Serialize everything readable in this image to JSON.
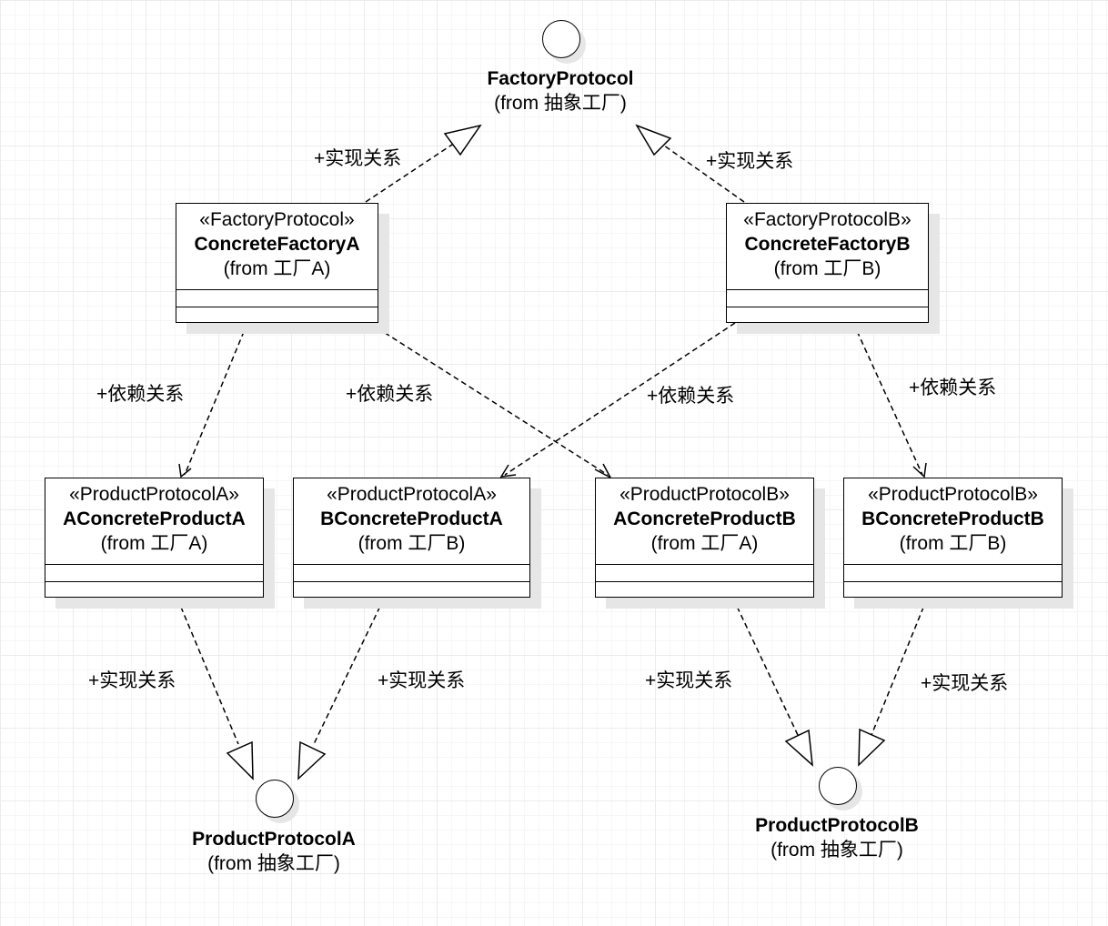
{
  "interfaces": {
    "factory_protocol": {
      "name": "FactoryProtocol",
      "from": "(from 抽象工厂)"
    },
    "product_protocol_a": {
      "name": "ProductProtocolA",
      "from": "(from 抽象工厂)"
    },
    "product_protocol_b": {
      "name": "ProductProtocolB",
      "from": "(from 抽象工厂)"
    }
  },
  "classes": {
    "concrete_factory_a": {
      "stereotype": "«FactoryProtocol»",
      "name": "ConcreteFactoryA",
      "from": "(from 工厂A)"
    },
    "concrete_factory_b": {
      "stereotype": "«FactoryProtocolB»",
      "name": "ConcreteFactoryB",
      "from": "(from 工厂B)"
    },
    "a_concrete_product_a": {
      "stereotype": "«ProductProtocolA»",
      "name": "AConcreteProductA",
      "from": "(from 工厂A)"
    },
    "b_concrete_product_a": {
      "stereotype": "«ProductProtocolA»",
      "name": "BConcreteProductA",
      "from": "(from 工厂B)"
    },
    "a_concrete_product_b": {
      "stereotype": "«ProductProtocolB»",
      "name": "AConcreteProductB",
      "from": "(from 工厂A)"
    },
    "b_concrete_product_b": {
      "stereotype": "«ProductProtocolB»",
      "name": "BConcreteProductB",
      "from": "(from 工厂B)"
    }
  },
  "relations": {
    "factory_a_realizes": "+实现关系",
    "factory_b_realizes": "+实现关系",
    "factory_a_depends_product_a": "+依赖关系",
    "factory_a_depends_product_b": "+依赖关系",
    "factory_b_depends_product_a": "+依赖关系",
    "factory_b_depends_product_b": "+依赖关系",
    "a_product_a_realizes": "+实现关系",
    "b_product_a_realizes": "+实现关系",
    "a_product_b_realizes": "+实现关系",
    "b_product_b_realizes": "+实现关系"
  }
}
